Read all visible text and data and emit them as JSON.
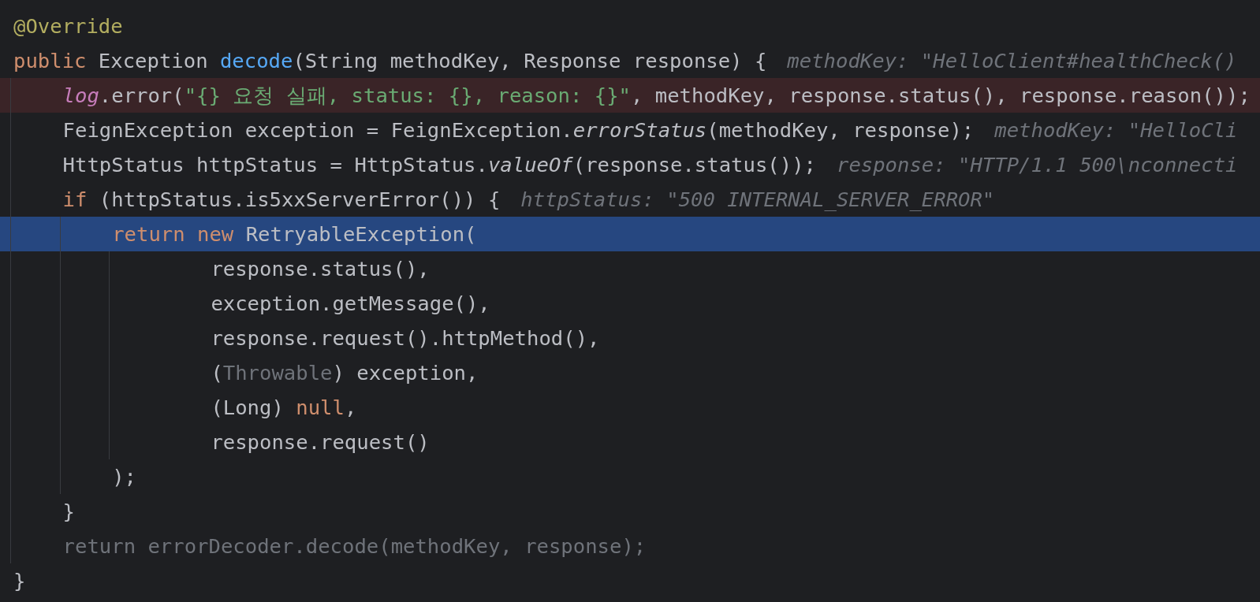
{
  "lines": [
    {
      "selected": false,
      "error": false,
      "tokens": [
        {
          "kind": "annotation",
          "text": "@Override"
        }
      ]
    },
    {
      "selected": false,
      "error": false,
      "tokens": [
        {
          "kind": "keyword",
          "text": "public"
        },
        {
          "kind": "plain",
          "text": " Exception "
        },
        {
          "kind": "declaration",
          "text": "decode"
        },
        {
          "kind": "plain",
          "text": "(String methodKey, Response response) {"
        }
      ],
      "hint": "methodKey: \"HelloClient#healthCheck()",
      "children": [
        {
          "selected": false,
          "error": true,
          "tokens": [
            {
              "kind": "field",
              "text": "log"
            },
            {
              "kind": "plain",
              "text": ".error("
            },
            {
              "kind": "string",
              "text": "\"{} 요청 실패, status: {}, reason: {}\""
            },
            {
              "kind": "plain",
              "text": ", methodKey, response.status(), response.reason());"
            }
          ]
        },
        {
          "selected": false,
          "error": false,
          "tokens": [
            {
              "kind": "plain",
              "text": "FeignException exception = FeignException."
            },
            {
              "kind": "static",
              "text": "errorStatus"
            },
            {
              "kind": "plain",
              "text": "(methodKey, response);"
            }
          ],
          "hint": "methodKey: \"HelloCli"
        },
        {
          "selected": false,
          "error": false,
          "tokens": [
            {
              "kind": "plain",
              "text": "HttpStatus httpStatus = HttpStatus."
            },
            {
              "kind": "static",
              "text": "valueOf"
            },
            {
              "kind": "plain",
              "text": "(response.status());"
            }
          ],
          "hint": "response: \"HTTP/1.1 500\\nconnecti"
        },
        {
          "selected": false,
          "error": false,
          "tokens": [
            {
              "kind": "keyword",
              "text": "if"
            },
            {
              "kind": "plain",
              "text": " (httpStatus.is5xxServerError()) {"
            }
          ],
          "hint": "httpStatus: \"500 INTERNAL_SERVER_ERROR\"",
          "children": [
            {
              "selected": true,
              "error": false,
              "tokens": [
                {
                  "kind": "keyword",
                  "text": "return new"
                },
                {
                  "kind": "plain",
                  "text": " RetryableException("
                }
              ],
              "children": [
                {
                  "children": [
                    {
                      "selected": false,
                      "error": false,
                      "tokens": [
                        {
                          "kind": "plain",
                          "text": "response.status(),"
                        }
                      ]
                    },
                    {
                      "selected": false,
                      "error": false,
                      "tokens": [
                        {
                          "kind": "plain",
                          "text": "exception.getMessage(),"
                        }
                      ]
                    },
                    {
                      "selected": false,
                      "error": false,
                      "tokens": [
                        {
                          "kind": "plain",
                          "text": "response.request().httpMethod(),"
                        }
                      ]
                    },
                    {
                      "selected": false,
                      "error": false,
                      "tokens": [
                        {
                          "kind": "plain",
                          "text": "("
                        },
                        {
                          "kind": "muted",
                          "text": "Throwable"
                        },
                        {
                          "kind": "plain",
                          "text": ") exception,"
                        }
                      ]
                    },
                    {
                      "selected": false,
                      "error": false,
                      "tokens": [
                        {
                          "kind": "plain",
                          "text": "(Long) "
                        },
                        {
                          "kind": "keyword",
                          "text": "null"
                        },
                        {
                          "kind": "plain",
                          "text": ","
                        }
                      ]
                    },
                    {
                      "selected": false,
                      "error": false,
                      "tokens": [
                        {
                          "kind": "plain",
                          "text": "response.request()"
                        }
                      ]
                    }
                  ]
                }
              ]
            },
            {
              "selected": false,
              "error": false,
              "tokens": [
                {
                  "kind": "plain",
                  "text": ");"
                }
              ]
            }
          ]
        },
        {
          "selected": false,
          "error": false,
          "tokens": [
            {
              "kind": "plain",
              "text": "}"
            }
          ]
        },
        {
          "selected": false,
          "error": false,
          "tokens": [
            {
              "kind": "muted",
              "text": "return errorDecoder.decode(methodKey, response);"
            }
          ]
        }
      ]
    },
    {
      "selected": false,
      "error": false,
      "tokens": [
        {
          "kind": "plain",
          "text": "}"
        }
      ]
    }
  ]
}
